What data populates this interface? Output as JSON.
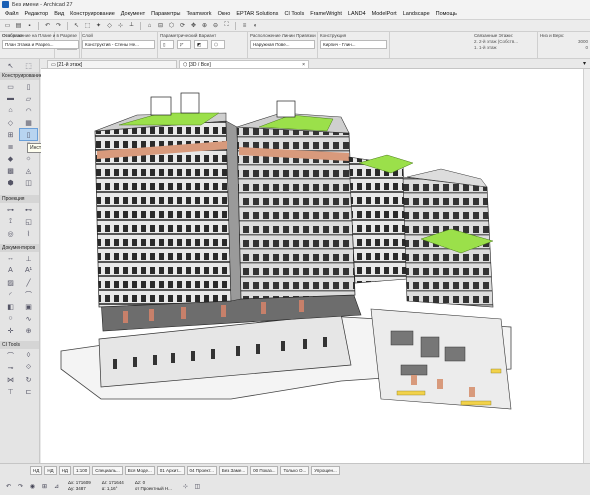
{
  "window": {
    "title": "Без имени - Archicad 27"
  },
  "menu": [
    "Файл",
    "Редактор",
    "Вид",
    "Конструирование",
    "Документ",
    "Параметры",
    "Teamwork",
    "Окно",
    "EPTAR Solutions",
    "CI Tools",
    "FrameWright",
    "LAND4",
    "ModelPort",
    "Landscape",
    "Помощь"
  ],
  "infobox": {
    "base": {
      "label": "Основная",
      "value": "Параметры по Умолчанию"
    },
    "layer": {
      "label": "Слой",
      "value": "Конструктив - Стены Не..."
    },
    "param": {
      "label": "Параметрический Вариант"
    },
    "location": {
      "label": "Расположение Линии Привязки",
      "value": "Наружная Пове..."
    },
    "construction": {
      "label": "Конструкция",
      "value": "Кирпич - Глин..."
    },
    "display": {
      "label": "Отображение на Плане и в Разрезе",
      "value": "План Этажа и Разрез..."
    },
    "floors": {
      "label": "Связанные Этажи:",
      "line1": "2. 2-й этаж (Собств...",
      "line2": "1. 1-й этаж"
    },
    "height": {
      "label": "Низ и Верх:",
      "value": "3000",
      "value2": "0"
    }
  },
  "toolbox": {
    "sections": [
      "Конструирование",
      "Проекция",
      "Документиров",
      "CI Tools"
    ],
    "tooltip": "Инструмент Дверь"
  },
  "tabs": {
    "floor": "[21-й этаж]",
    "view3d": "[3D / Все]"
  },
  "statusbar": {
    "fields": [
      "НД",
      "НД",
      "НД",
      "1:100",
      "Специаль...",
      "Вся Моде...",
      "01 Архит...",
      "04 Проект...",
      "Без Заме...",
      "00 Показ...",
      "Только О...",
      "Упрощен..."
    ]
  },
  "coords": {
    "dx": "Δх: 171609",
    "dy": "Δу: 3487",
    "da": "Δr: 171644",
    "angle": "α: 1,16°",
    "dz": "Δz: 0",
    "ref": "от Проектный Н..."
  },
  "colors": {
    "accent": "#1a5fb4",
    "roof_green": "#9be04a",
    "salmon": "#d89a7c",
    "dark_wall": "#3a3a3a"
  }
}
